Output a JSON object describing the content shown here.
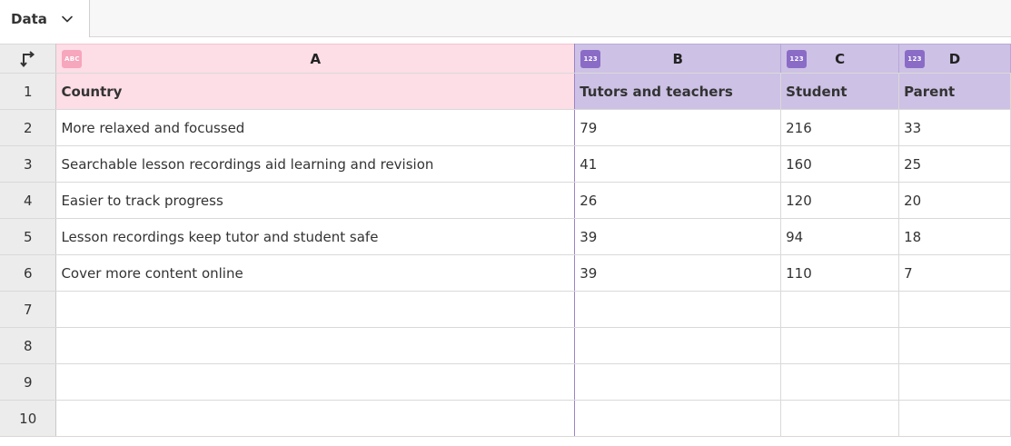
{
  "tab": {
    "label": "Data",
    "icon": "chevron-down-icon"
  },
  "corner": {
    "icon": "transpose-arrow-icon"
  },
  "columns": [
    {
      "letter": "A",
      "type_badge": "ABC"
    },
    {
      "letter": "B",
      "type_badge": "123"
    },
    {
      "letter": "C",
      "type_badge": "123"
    },
    {
      "letter": "D",
      "type_badge": "123"
    }
  ],
  "row_numbers": [
    "1",
    "2",
    "3",
    "4",
    "5",
    "6",
    "7",
    "8",
    "9",
    "10"
  ],
  "rows": [
    [
      "Country",
      "Tutors and teachers",
      "Student",
      "Parent"
    ],
    [
      "More relaxed and focussed",
      "79",
      "216",
      "33"
    ],
    [
      "Searchable lesson recordings aid learning and revision",
      "41",
      "160",
      "25"
    ],
    [
      "Easier to track progress",
      "26",
      "120",
      "20"
    ],
    [
      "Lesson recordings keep tutor and student safe",
      "39",
      "94",
      "18"
    ],
    [
      "Cover more content online",
      "39",
      "110",
      "7"
    ],
    [
      "",
      "",
      "",
      ""
    ],
    [
      "",
      "",
      "",
      ""
    ],
    [
      "",
      "",
      "",
      ""
    ],
    [
      "",
      "",
      "",
      ""
    ]
  ],
  "colors": {
    "text_column": "#fddde6",
    "number_column": "#cdc1e5",
    "number_badge": "#8a6cc7",
    "text_badge": "#f6a6bd"
  }
}
